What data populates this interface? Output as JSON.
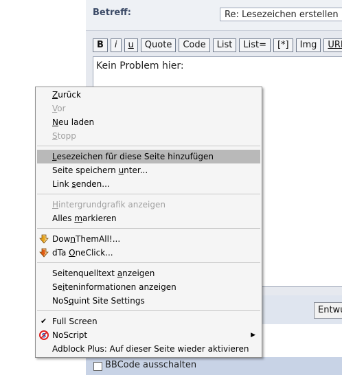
{
  "form": {
    "subject_label": "Betreff:",
    "subject_value": "Re: Lesezeichen  erstellen",
    "toolbar": [
      "B",
      "i",
      "u",
      "Quote",
      "Code",
      "List",
      "List=",
      "[*]",
      "Img",
      "URL"
    ],
    "editor_text": "Kein Problem hier:",
    "draft_button": "Entwu",
    "bbcode_option": "BBCode ausschalten"
  },
  "context_menu": {
    "groups": [
      {
        "items": [
          {
            "label": "Zurück",
            "accel": "Z",
            "rest": "urück",
            "pre": "",
            "disabled": false
          },
          {
            "label": "Vor",
            "pre": "",
            "accel": "V",
            "rest": "or",
            "disabled": true
          },
          {
            "label": "Neu laden",
            "pre": "",
            "accel": "N",
            "rest": "eu laden",
            "disabled": false
          },
          {
            "label": "Stopp",
            "pre": "",
            "accel": "S",
            "rest": "topp",
            "disabled": true
          }
        ]
      },
      {
        "items": [
          {
            "label": "Lesezeichen für diese Seite hinzufügen",
            "pre": "",
            "accel": "L",
            "rest": "esezeichen für diese Seite hinzufügen",
            "highlighted": true
          },
          {
            "label": "Seite speichern unter...",
            "pre": "Seite speichern ",
            "accel": "u",
            "rest": "nter..."
          },
          {
            "label": "Link senden...",
            "pre": "Link ",
            "accel": "s",
            "rest": "enden..."
          }
        ]
      },
      {
        "items": [
          {
            "label": "Hintergrundgrafik anzeigen",
            "pre": "",
            "accel": "H",
            "rest": "intergrundgrafik anzeigen",
            "disabled": true
          },
          {
            "label": "Alles markieren",
            "pre": "Alles ",
            "accel": "m",
            "rest": "arkieren"
          }
        ]
      },
      {
        "items": [
          {
            "label": "DownThemAll!...",
            "pre": "Dow",
            "accel": "n",
            "rest": "ThemAll!...",
            "icon": "downthemall-icon"
          },
          {
            "label": "dTa OneClick...",
            "pre": "dTa ",
            "accel": "O",
            "rest": "neClick...",
            "icon": "dta-oneclick-icon"
          }
        ]
      },
      {
        "items": [
          {
            "label": "Seitenquelltext anzeigen",
            "pre": "Seitenquelltext ",
            "accel": "a",
            "rest": "nzeigen"
          },
          {
            "label": "Seiteninformationen anzeigen",
            "pre": "Se",
            "accel": "i",
            "rest": "teninformationen anzeigen"
          },
          {
            "label": "NoSquint Site Settings",
            "pre": "NoS",
            "accel": "q",
            "rest": "uint Site Settings"
          }
        ]
      },
      {
        "items": [
          {
            "label": "Full Screen",
            "pre": "Full Screen",
            "accel": "",
            "rest": "",
            "checked": true
          },
          {
            "label": "NoScript",
            "pre": "NoScript",
            "accel": "",
            "rest": "",
            "icon": "noscript-icon",
            "submenu": true
          },
          {
            "label": "Adblock Plus: Auf dieser Seite wieder aktivieren",
            "pre": "Adblock Plus: Auf dieser Seite wieder aktivieren",
            "accel": "",
            "rest": ""
          }
        ]
      }
    ]
  },
  "colors": {
    "menu_bg": "#f5f5f5",
    "menu_highlight": "#b9b9b9",
    "disabled_text": "#a0a0a0",
    "page_bg": "#e6e9ef",
    "option_row_bg": "#c8d3e6"
  }
}
